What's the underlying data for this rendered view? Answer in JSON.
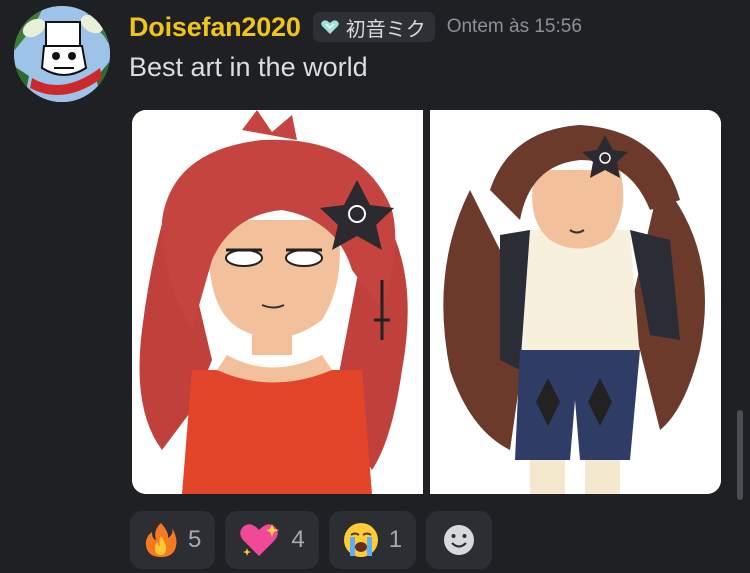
{
  "author": {
    "username": "Doisefan2020",
    "tag": "初音ミク",
    "timestamp": "Ontem às 15:56"
  },
  "message": {
    "text": "Best art in the world",
    "attachments": [
      {
        "name": "drawing-red-hair-girl"
      },
      {
        "name": "drawing-brown-hair-girl"
      }
    ]
  },
  "reactions": [
    {
      "emoji": "fire-icon",
      "count": "5"
    },
    {
      "emoji": "sparkling-heart-icon",
      "count": "4"
    },
    {
      "emoji": "loudly-crying-face-icon",
      "count": "1"
    }
  ],
  "colors": {
    "background": "#1f2024",
    "username": "#f0c419",
    "text": "#dcdde0",
    "timestamp": "#8e9096",
    "reaction_bg": "#2c2e33"
  }
}
